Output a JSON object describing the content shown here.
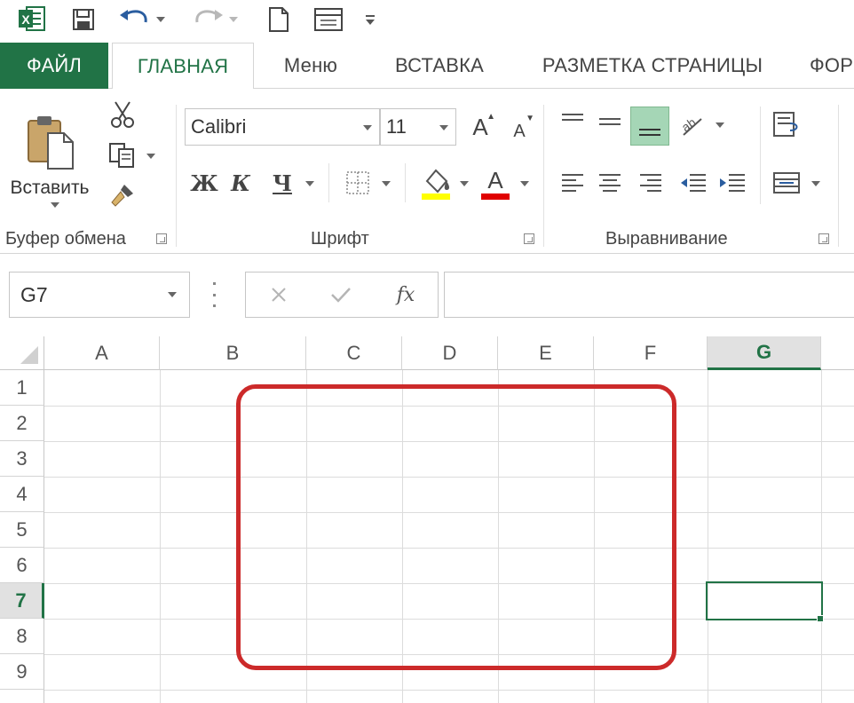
{
  "quick_access": {
    "app_icon": "excel-logo",
    "items": [
      "save-icon",
      "undo-icon",
      "redo-icon",
      "new-document-icon",
      "print-preview-icon",
      "customize-toolbar-icon"
    ]
  },
  "tabs": [
    {
      "label": "ФАЙЛ",
      "active": false
    },
    {
      "label": "ГЛАВНАЯ",
      "active": true
    },
    {
      "label": "Меню",
      "active": false
    },
    {
      "label": "ВСТАВКА",
      "active": false
    },
    {
      "label": "РАЗМЕТКА СТРАНИЦЫ",
      "active": false
    },
    {
      "label": "ФОР",
      "active": false
    }
  ],
  "ribbon": {
    "clipboard": {
      "group_label": "Буфер обмена",
      "paste_label": "Вставить"
    },
    "font": {
      "group_label": "Шрифт",
      "font_name": "Calibri",
      "font_size": "11",
      "bold_label": "Ж",
      "italic_label": "К",
      "underline_label": "Ч",
      "grow_label": "A",
      "shrink_label": "A",
      "font_color_label": "A",
      "fill_color": "#ffff00",
      "font_color": "#e00000"
    },
    "alignment": {
      "group_label": "Выравнивание"
    }
  },
  "formula_bar": {
    "name_box": "G7",
    "fx_label": "fx",
    "formula": ""
  },
  "grid": {
    "columns": [
      "A",
      "B",
      "C",
      "D",
      "E",
      "F",
      "G"
    ],
    "rows": [
      "1",
      "2",
      "3",
      "4",
      "5",
      "6",
      "7",
      "8",
      "9"
    ],
    "selected_column": "G",
    "selected_row": "7",
    "active_cell": "G7"
  },
  "colors": {
    "accent": "#217346",
    "highlight": "#cc2a2a"
  }
}
